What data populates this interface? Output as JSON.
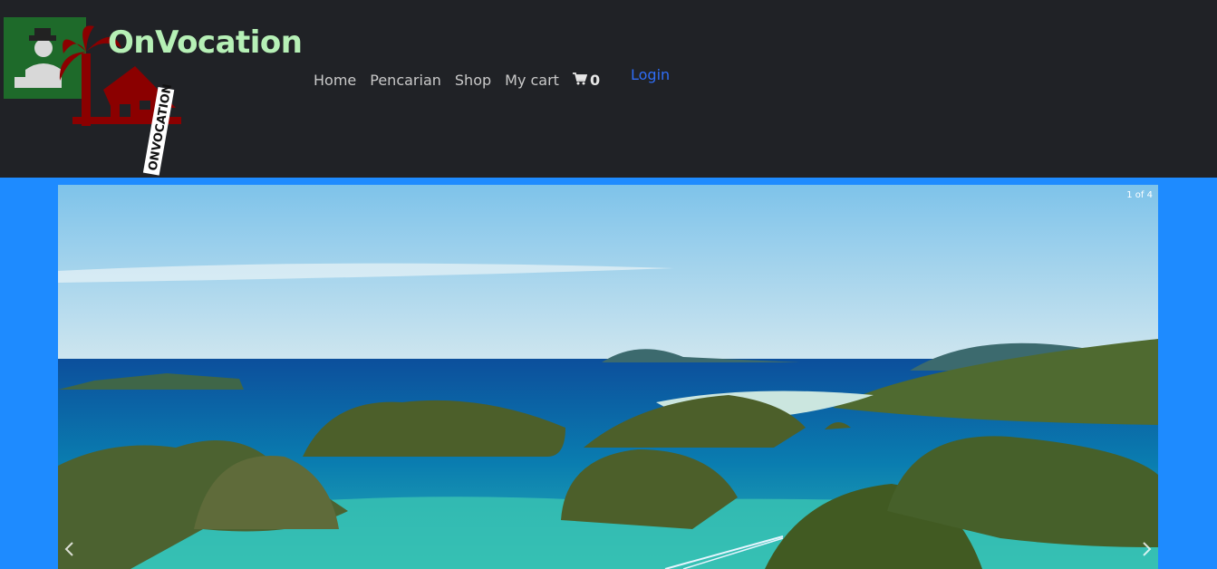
{
  "header": {
    "brand": "OnVocation",
    "logo_text": "ONVOCATION"
  },
  "nav": {
    "items": [
      {
        "label": "Home"
      },
      {
        "label": "Pencarian"
      },
      {
        "label": "Shop"
      },
      {
        "label": "My cart"
      }
    ],
    "cart_count": "0",
    "login_label": "Login"
  },
  "carousel": {
    "counter": "1 of 4",
    "image": "raja-ampat-islands-landscape"
  },
  "colors": {
    "topbar": "#202226",
    "page_bg": "#1e8bff",
    "brand": "#b6f0b6",
    "login": "#2f6df6",
    "logo_red": "#8b0000",
    "logo_green": "#1e6a2a"
  }
}
